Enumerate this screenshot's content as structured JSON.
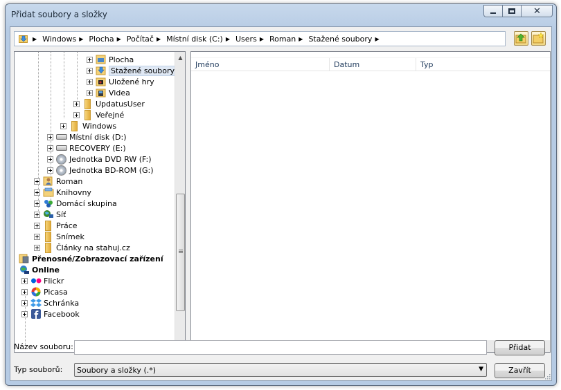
{
  "window": {
    "title": "Přidat soubory a složky"
  },
  "address": {
    "crumbs": [
      "Windows",
      "Plocha",
      "Počítač",
      "Místní disk (C:)",
      "Users",
      "Roman",
      "Stažené soubory"
    ]
  },
  "tree": {
    "items": [
      {
        "label": "Plocha",
        "icon": "desktop-icon"
      },
      {
        "label": "Stažené soubory",
        "icon": "downloads-icon"
      },
      {
        "label": "Uložené hry",
        "icon": "saved-games-icon"
      },
      {
        "label": "Videa",
        "icon": "videos-icon"
      },
      {
        "label": "UpdatusUser",
        "icon": "folder-icon"
      },
      {
        "label": "Veřejné",
        "icon": "folder-icon"
      },
      {
        "label": "Windows",
        "icon": "folder-icon"
      },
      {
        "label": "Místní disk (D:)",
        "icon": "hard-drive-icon"
      },
      {
        "label": "RECOVERY (E:)",
        "icon": "hard-drive-icon"
      },
      {
        "label": "Jednotka DVD RW (F:)",
        "icon": "dvd-drive-icon"
      },
      {
        "label": "Jednotka BD-ROM (G:)",
        "icon": "bd-drive-icon"
      },
      {
        "label": "Roman",
        "icon": "user-icon"
      },
      {
        "label": "Knihovny",
        "icon": "libraries-icon"
      },
      {
        "label": "Domácí skupina",
        "icon": "homegroup-icon"
      },
      {
        "label": "Síť",
        "icon": "network-icon"
      },
      {
        "label": "Práce",
        "icon": "folder-icon"
      },
      {
        "label": "Snímek",
        "icon": "folder-icon"
      },
      {
        "label": "Články na stahuj.cz",
        "icon": "folder-icon"
      },
      {
        "label": "Přenosné/Zobrazovací zařízení",
        "icon": "portable-device-icon"
      },
      {
        "label": "Online",
        "icon": "online-icon"
      },
      {
        "label": "Flickr",
        "icon": "flickr-icon"
      },
      {
        "label": "Picasa",
        "icon": "picasa-icon"
      },
      {
        "label": "Schránka",
        "icon": "dropbox-icon"
      },
      {
        "label": "Facebook",
        "icon": "facebook-icon"
      }
    ]
  },
  "filelist": {
    "columns": [
      "Jméno",
      "Datum",
      "Typ"
    ]
  },
  "form": {
    "filename_label": "Název souboru:",
    "filename_value": "",
    "filetype_label": "Typ souborů:",
    "filetype_value": "Soubory a složky (.*)",
    "add_button": "Přidat",
    "close_button": "Zavřít"
  }
}
